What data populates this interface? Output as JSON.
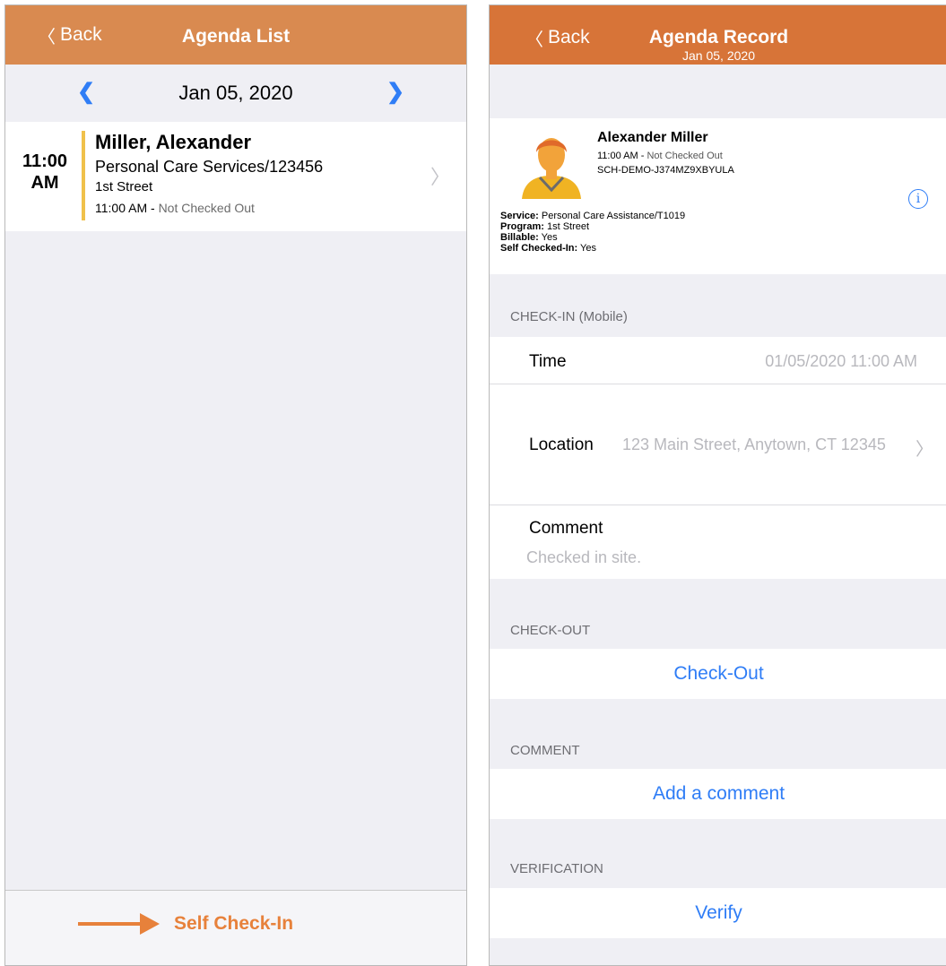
{
  "left": {
    "nav": {
      "back_label": "Back",
      "title": "Agenda List"
    },
    "date_bar": {
      "date": "Jan 05, 2020"
    },
    "agenda_item": {
      "time_hour": "11:00",
      "time_period": "AM",
      "name": "Miller, Alexander",
      "service": "Personal Care Services/123456",
      "program": "1st Street",
      "status_time": "11:00 AM -",
      "status_text": "Not Checked Out"
    },
    "bottom": {
      "self_checkin_label": "Self Check-In"
    }
  },
  "right": {
    "nav": {
      "back_label": "Back",
      "title": "Agenda Record",
      "subtitle": "Jan 05, 2020"
    },
    "profile": {
      "name": "Alexander Miller",
      "status_time": "11:00 AM -",
      "status_text": "Not Checked Out",
      "schedule_id": "SCH-DEMO-J374MZ9XBYULA",
      "service_label": "Service:",
      "service_value": "Personal Care Assistance/T1019",
      "program_label": "Program:",
      "program_value": "1st Street",
      "billable_label": "Billable:",
      "billable_value": "Yes",
      "self_checked_label": "Self Checked-In:",
      "self_checked_value": "Yes"
    },
    "checkin": {
      "header": "CHECK-IN (Mobile)",
      "time_label": "Time",
      "time_value": "01/05/2020 11:00 AM",
      "location_label": "Location",
      "location_value": "123 Main Street, Anytown, CT 12345",
      "comment_label": "Comment",
      "comment_value": "Checked in site."
    },
    "checkout": {
      "header": "CHECK-OUT",
      "button": "Check-Out"
    },
    "comment": {
      "header": "COMMENT",
      "button": "Add a comment"
    },
    "verification": {
      "header": "VERIFICATION",
      "button": "Verify"
    }
  },
  "colors": {
    "left_navbar": "#d98a50",
    "right_navbar": "#d77438",
    "accent_orange": "#e7813b",
    "link_blue": "#2f7df6",
    "status_bar_yellow": "#f0c14b"
  }
}
